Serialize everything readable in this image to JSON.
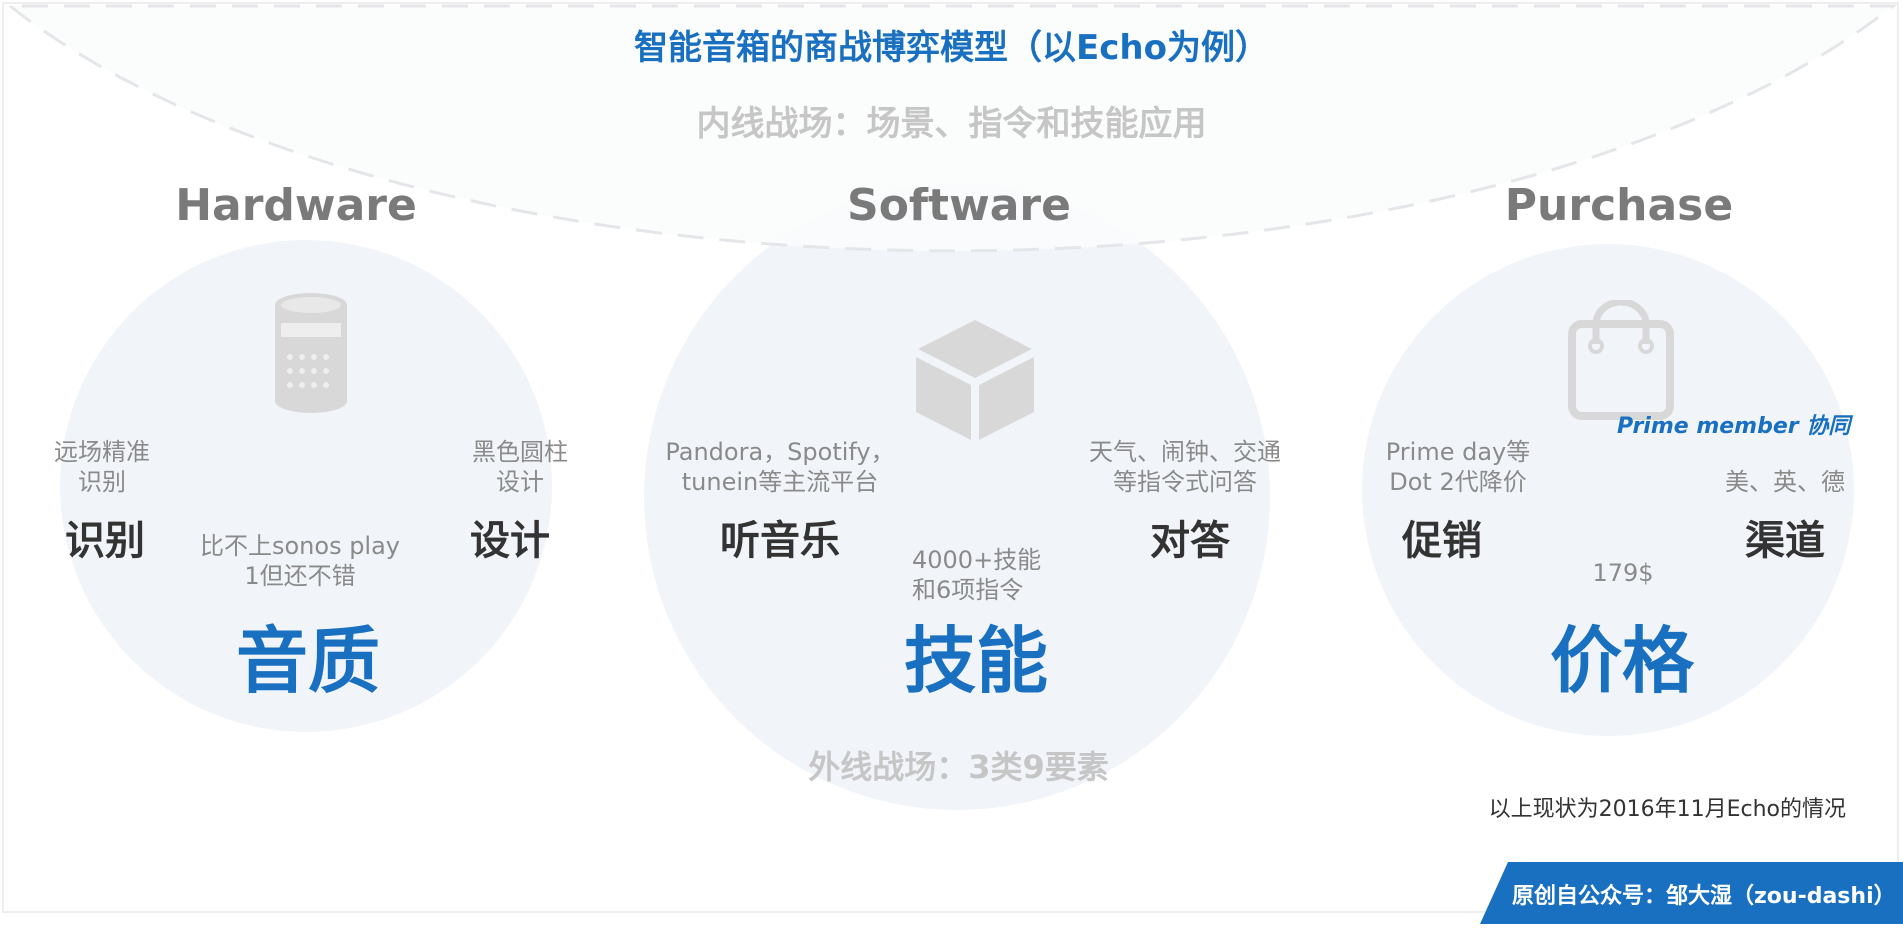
{
  "title": "智能音箱的商战博弈模型（以Echo为例）",
  "inner_battlefield": "内线战场：场景、指令和技能应用",
  "outer_battlefield": "外线战场：3类9要素",
  "hardware": {
    "heading": "Hardware",
    "icon": "speaker-icon",
    "core": "音质",
    "core_note": [
      "比不上sonos play",
      "1但还不错"
    ],
    "left": {
      "note": [
        "远场精准",
        "识别"
      ],
      "label": "识别"
    },
    "right": {
      "note": [
        "黑色圆柱",
        "设计"
      ],
      "label": "设计"
    }
  },
  "software": {
    "heading": "Software",
    "icon": "cube-icon",
    "core": "技能",
    "core_note": [
      "4000+技能",
      "和6项指令"
    ],
    "left": {
      "note": [
        "Pandora，Spotify，",
        "tunein等主流平台"
      ],
      "label": "听音乐"
    },
    "right": {
      "note": [
        "天气、闹钟、交通",
        "等指令式问答"
      ],
      "label": "对答"
    }
  },
  "purchase": {
    "heading": "Purchase",
    "icon": "shopping-bag-icon",
    "core": "价格",
    "core_note": "179$",
    "prime": "Prime member 协同",
    "left": {
      "note": [
        "Prime day等",
        "Dot 2代降价"
      ],
      "label": "促销"
    },
    "right": {
      "note": "美、英、德",
      "label": "渠道"
    }
  },
  "footnote": "以上现状为2016年11月Echo的情况",
  "source": "原创自公众号：邹大湿（zou-dashi）",
  "colors": {
    "accent": "#1a70c0",
    "circle_fill": "#f1f5fa",
    "arc_fill": "#f7f8fa",
    "muted_text": "#8a8a8a",
    "dark_text": "#333333",
    "icon_gray": "#d8d8d8"
  }
}
